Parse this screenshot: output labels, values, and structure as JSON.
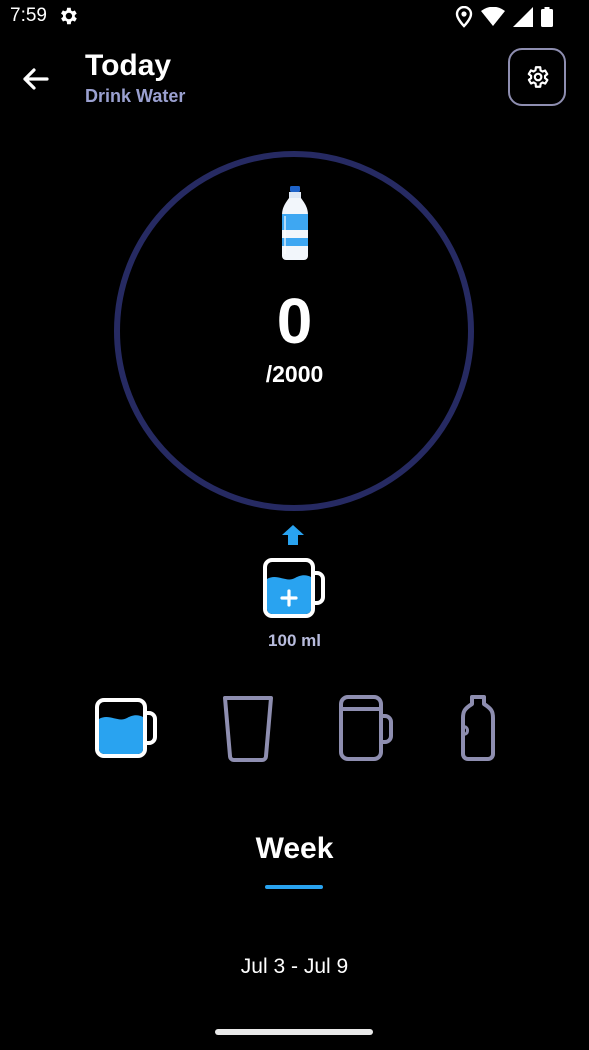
{
  "status_bar": {
    "time": "7:59"
  },
  "header": {
    "title": "Today",
    "subtitle": "Drink Water"
  },
  "progress": {
    "current": "0",
    "goal": "/2000",
    "fraction": 0
  },
  "selected_serving": {
    "label": "100 ml"
  },
  "vessels": [
    "mug",
    "glass",
    "beer-mug",
    "bottle"
  ],
  "tabs": {
    "active": "Week"
  },
  "date_range": "Jul 3 - Jul 9",
  "colors": {
    "accent": "#29a3f0",
    "ring": "#262a62",
    "outline": "#8e8eb0"
  }
}
